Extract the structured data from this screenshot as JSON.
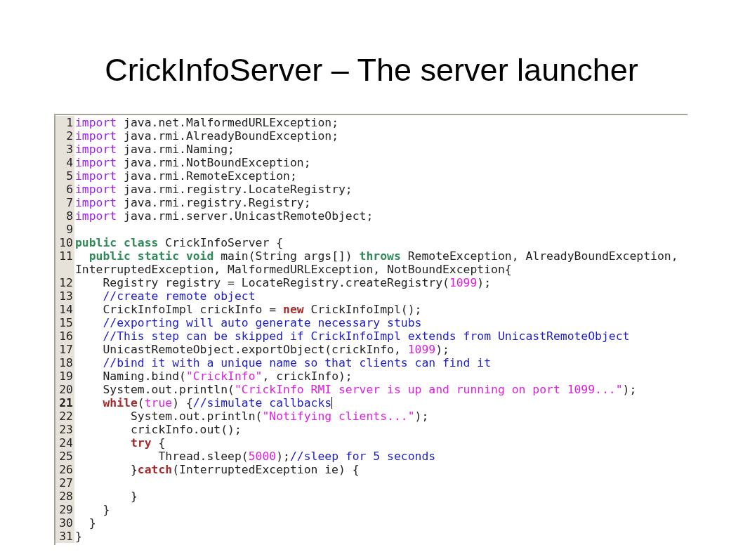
{
  "slide": {
    "title": "CrickInfoServer – The server launcher"
  },
  "editor": {
    "lines": [
      {
        "number": "1",
        "current": false,
        "tokens": [
          {
            "kind": "import",
            "text": "import"
          },
          {
            "kind": "plain",
            "text": " java.net.MalformedURLException;"
          }
        ]
      },
      {
        "number": "2",
        "current": false,
        "tokens": [
          {
            "kind": "import",
            "text": "import"
          },
          {
            "kind": "plain",
            "text": " java.rmi.AlreadyBoundException;"
          }
        ]
      },
      {
        "number": "3",
        "current": false,
        "tokens": [
          {
            "kind": "import",
            "text": "import"
          },
          {
            "kind": "plain",
            "text": " java.rmi.Naming;"
          }
        ]
      },
      {
        "number": "4",
        "current": false,
        "tokens": [
          {
            "kind": "import",
            "text": "import"
          },
          {
            "kind": "plain",
            "text": " java.rmi.NotBoundException;"
          }
        ]
      },
      {
        "number": "5",
        "current": false,
        "tokens": [
          {
            "kind": "import",
            "text": "import"
          },
          {
            "kind": "plain",
            "text": " java.rmi.RemoteException;"
          }
        ]
      },
      {
        "number": "6",
        "current": false,
        "tokens": [
          {
            "kind": "import",
            "text": "import"
          },
          {
            "kind": "plain",
            "text": " java.rmi.registry.LocateRegistry;"
          }
        ]
      },
      {
        "number": "7",
        "current": false,
        "tokens": [
          {
            "kind": "import",
            "text": "import"
          },
          {
            "kind": "plain",
            "text": " java.rmi.registry.Registry;"
          }
        ]
      },
      {
        "number": "8",
        "current": false,
        "tokens": [
          {
            "kind": "import",
            "text": "import"
          },
          {
            "kind": "plain",
            "text": " java.rmi.server.UnicastRemoteObject;"
          }
        ]
      },
      {
        "number": "9",
        "current": false
      },
      {
        "number": "10",
        "current": false,
        "tokens": [
          {
            "kind": "modifier",
            "text": "public class"
          },
          {
            "kind": "plain",
            "text": " CrickInfoServer {"
          }
        ]
      },
      {
        "number": "11",
        "current": false,
        "tokens": [
          {
            "kind": "modifier",
            "text": "  public static void"
          },
          {
            "kind": "plain",
            "text": " main(String args[]) "
          },
          {
            "kind": "modifier",
            "text": "throws"
          },
          {
            "kind": "plain",
            "text": " RemoteException, AlreadyBoundException,"
          }
        ],
        "continuation": [
          {
            "kind": "plain",
            "text": "InterruptedException, MalformedURLException, NotBoundException{"
          }
        ]
      },
      {
        "number": "12",
        "current": false,
        "tokens": [
          {
            "kind": "plain",
            "text": "    Registry registry = LocateRegistry.createRegistry("
          },
          {
            "kind": "literal",
            "text": "1099"
          },
          {
            "kind": "plain",
            "text": ");"
          }
        ]
      },
      {
        "number": "13",
        "current": false,
        "tokens": [
          {
            "kind": "comment",
            "text": "    //create remote object"
          }
        ]
      },
      {
        "number": "14",
        "current": false,
        "tokens": [
          {
            "kind": "plain",
            "text": "    CrickInfoImpl crickInfo = "
          },
          {
            "kind": "control",
            "text": "new"
          },
          {
            "kind": "plain",
            "text": " CrickInfoImpl();"
          }
        ]
      },
      {
        "number": "15",
        "current": false,
        "tokens": [
          {
            "kind": "comment",
            "text": "    //exporting will auto generate necessary stubs"
          }
        ]
      },
      {
        "number": "16",
        "current": false,
        "tokens": [
          {
            "kind": "comment",
            "text": "    //This step can be skipped if CrickInfoImpl extends from UnicastRemoteObject"
          }
        ]
      },
      {
        "number": "17",
        "current": false,
        "tokens": [
          {
            "kind": "plain",
            "text": "    UnicastRemoteObject.exportObject(crickInfo, "
          },
          {
            "kind": "literal",
            "text": "1099"
          },
          {
            "kind": "plain",
            "text": ");"
          }
        ]
      },
      {
        "number": "18",
        "current": false,
        "tokens": [
          {
            "kind": "comment",
            "text": "    //bind it with a unique name so that clients can find it"
          }
        ]
      },
      {
        "number": "19",
        "current": false,
        "tokens": [
          {
            "kind": "plain",
            "text": "    Naming.bind("
          },
          {
            "kind": "literal",
            "text": "\"CrickInfo\""
          },
          {
            "kind": "plain",
            "text": ", crickInfo);"
          }
        ]
      },
      {
        "number": "20",
        "current": false,
        "tokens": [
          {
            "kind": "plain",
            "text": "    System.out.println("
          },
          {
            "kind": "literal",
            "text": "\"CrickInfo RMI server is up and running on port 1099...\""
          },
          {
            "kind": "plain",
            "text": ");"
          }
        ]
      },
      {
        "number": "21",
        "current": true,
        "tokens": [
          {
            "kind": "control",
            "text": "    while"
          },
          {
            "kind": "plain",
            "text": "("
          },
          {
            "kind": "literal",
            "text": "true"
          },
          {
            "kind": "plain",
            "text": ") {"
          },
          {
            "kind": "comment",
            "text": "//simulate callbacks"
          }
        ]
      },
      {
        "number": "22",
        "current": false,
        "tokens": [
          {
            "kind": "plain",
            "text": "        System.out.println("
          },
          {
            "kind": "literal",
            "text": "\"Notifying clients...\""
          },
          {
            "kind": "plain",
            "text": ");"
          }
        ]
      },
      {
        "number": "23",
        "current": false,
        "tokens": [
          {
            "kind": "plain",
            "text": "        crickInfo.out();"
          }
        ]
      },
      {
        "number": "24",
        "current": false,
        "tokens": [
          {
            "kind": "control",
            "text": "        try"
          },
          {
            "kind": "plain",
            "text": " {"
          }
        ]
      },
      {
        "number": "25",
        "current": false,
        "tokens": [
          {
            "kind": "plain",
            "text": "            Thread.sleep("
          },
          {
            "kind": "literal",
            "text": "5000"
          },
          {
            "kind": "plain",
            "text": ");"
          },
          {
            "kind": "comment",
            "text": "//sleep for 5 seconds"
          }
        ]
      },
      {
        "number": "26",
        "current": false,
        "tokens": [
          {
            "kind": "plain",
            "text": "        }"
          },
          {
            "kind": "control",
            "text": "catch"
          },
          {
            "kind": "plain",
            "text": "(InterruptedException ie) {"
          }
        ]
      },
      {
        "number": "27",
        "current": false
      },
      {
        "number": "28",
        "current": false,
        "tokens": [
          {
            "kind": "plain",
            "text": "        }"
          }
        ]
      },
      {
        "number": "29",
        "current": false,
        "tokens": [
          {
            "kind": "plain",
            "text": "    }"
          }
        ]
      },
      {
        "number": "30",
        "current": false,
        "tokens": [
          {
            "kind": "plain",
            "text": "  }"
          }
        ]
      },
      {
        "number": "31",
        "current": false,
        "tokens": [
          {
            "kind": "plain",
            "text": "}"
          }
        ]
      }
    ]
  }
}
